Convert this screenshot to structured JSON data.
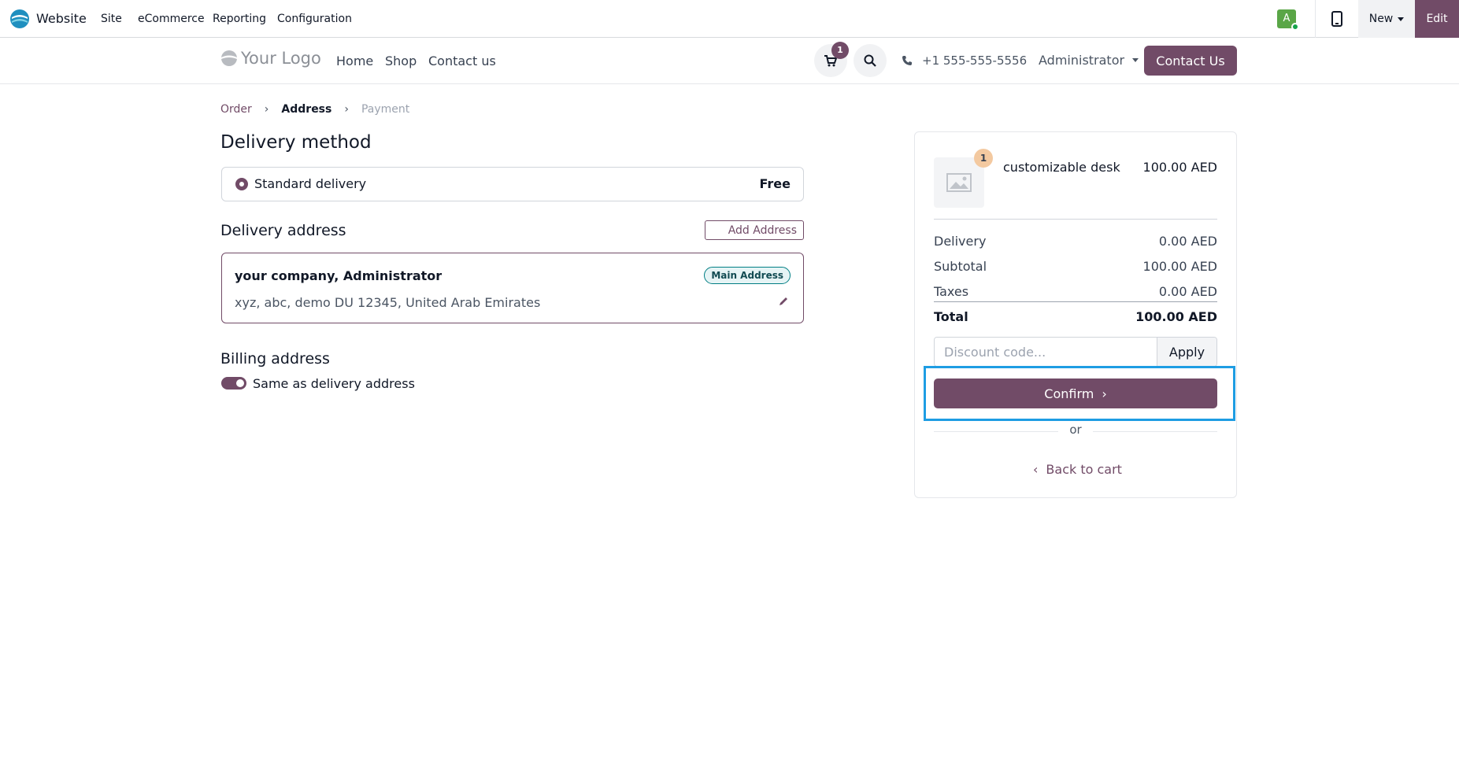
{
  "topbar": {
    "app_name": "Website",
    "menus": [
      "Site",
      "eCommerce",
      "Reporting",
      "Configuration"
    ],
    "avatar_letter": "A",
    "new_label": "New",
    "edit_label": "Edit",
    "accent_color": "#714b67"
  },
  "header": {
    "logo_text": "Your Logo",
    "nav": [
      "Home",
      "Shop",
      "Contact us"
    ],
    "cart_count": "1",
    "phone": "+1 555-555-5556",
    "user": "Administrator",
    "contact_button": "Contact Us"
  },
  "breadcrumb": {
    "order": "Order",
    "address": "Address",
    "payment": "Payment"
  },
  "delivery": {
    "title": "Delivery method",
    "method_label": "Standard delivery",
    "method_price": "Free"
  },
  "delivery_address": {
    "title": "Delivery address",
    "add_button": "Add Address",
    "name": "your company, Administrator",
    "badge": "Main Address",
    "details": "xyz, abc, demo DU 12345, United Arab Emirates"
  },
  "billing": {
    "title": "Billing address",
    "toggle_label": "Same as delivery address",
    "toggle_on": true
  },
  "summary": {
    "product_qty": "1",
    "product_name": "customizable desk",
    "product_price": "100.00 AED",
    "delivery_label": "Delivery",
    "delivery_value": "0.00 AED",
    "subtotal_label": "Subtotal",
    "subtotal_value": "100.00 AED",
    "taxes_label": "Taxes",
    "taxes_value": "0.00 AED",
    "total_label": "Total",
    "total_value": "100.00 AED",
    "discount_placeholder": "Discount code...",
    "apply_label": "Apply",
    "confirm_label": "Confirm",
    "or_label": "or",
    "back_label": "Back to cart",
    "highlight_color": "#1e9de3"
  }
}
